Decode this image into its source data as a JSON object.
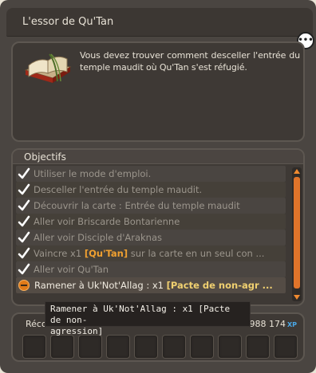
{
  "window": {
    "title": "L'essor de Qu'Tan"
  },
  "description": {
    "text": "Vous devez trouver comment desceller l'entrée du temple maudit où Qu'Tan s'est réfugié."
  },
  "objectives": {
    "header": "Objectifs",
    "items": [
      {
        "text": "Utiliser le mode d'emploi.",
        "done": true
      },
      {
        "text": "Desceller l'entrée du temple maudit.",
        "done": true
      },
      {
        "text": "Découvrir la carte : Entrée du temple maudit",
        "done": true
      },
      {
        "text": "Aller voir Briscarde Bontarienne",
        "done": true
      },
      {
        "text": "Aller voir Disciple d'Araknas",
        "done": true
      },
      {
        "pre": "Vaincre x1 ",
        "hl": "[Qu'Tan]",
        "post": " sur la carte  en un seul con ...",
        "done": true
      },
      {
        "text": "Aller voir Qu'Tan",
        "done": true
      },
      {
        "pre": "Ramener à Uk'Not'Allag : x1 ",
        "hl": "[Pacte de non-agr ...",
        "post": "",
        "done": false
      }
    ]
  },
  "rewards": {
    "label": "Réco",
    "xp_value": "988 174",
    "xp_unit": "XP",
    "slot_count": 10
  },
  "tooltip": {
    "line1": "Ramener à Uk'Not'Allag : x1 [Pacte de non-",
    "line2": "agression]"
  },
  "colors": {
    "accent": "#e0742a",
    "highlight": "#f0a030",
    "panel": "#3e3935"
  }
}
